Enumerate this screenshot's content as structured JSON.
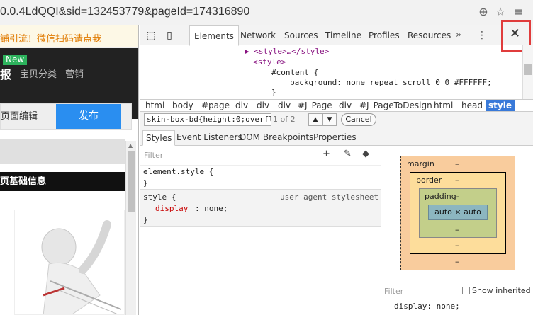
{
  "browser": {
    "url": "0.0.4LdQQI&sid=132453779&pageId=174316890"
  },
  "page": {
    "promo_text": "铺引流！微信扫码请点我",
    "new_badge": "New",
    "logo_text": "报",
    "nav_items": [
      "宝贝分类",
      "营销"
    ],
    "edit_label": "页面编辑",
    "publish_label": "发布",
    "basic_info": "页基础信息"
  },
  "devtools": {
    "tabs": [
      "Elements",
      "Network",
      "Sources",
      "Timeline",
      "Profiles",
      "Resources"
    ],
    "more": "»",
    "close": "✕",
    "code_lines": [
      {
        "text": "▶ <style>…</style>"
      },
      {
        "text": "<style>"
      },
      {
        "text": "#content {"
      },
      {
        "text": "background: none repeat scroll 0 0 #FFFFFF;"
      },
      {
        "text": "}"
      }
    ],
    "breadcrumbs": [
      "html",
      "body",
      "#page",
      "div",
      "div",
      "div",
      "#J_Page",
      "div",
      "#J_PageToDesign",
      "html",
      "head",
      "style"
    ],
    "search": {
      "value": "skin-box-bd{height:0;overflow:hi",
      "count": "1 of 2",
      "cancel": "Cancel"
    },
    "sidebar_tabs": [
      "Styles",
      "Event Listeners",
      "DOM Breakpoints",
      "Properties"
    ],
    "styles": {
      "filter_placeholder": "Filter",
      "element_style": "element.style {",
      "close_brace": "}",
      "ua_selector": "style {",
      "ua_source": "user agent stylesheet",
      "ua_prop": "display",
      "ua_value": ": none;"
    },
    "box_model": {
      "margin": "margin",
      "border": "border",
      "padding": "padding-",
      "content": "auto × auto",
      "dash": "–"
    },
    "computed": {
      "filter_placeholder": "Filter",
      "show_inherited": "Show inherited",
      "first_line": "display: none;"
    }
  }
}
